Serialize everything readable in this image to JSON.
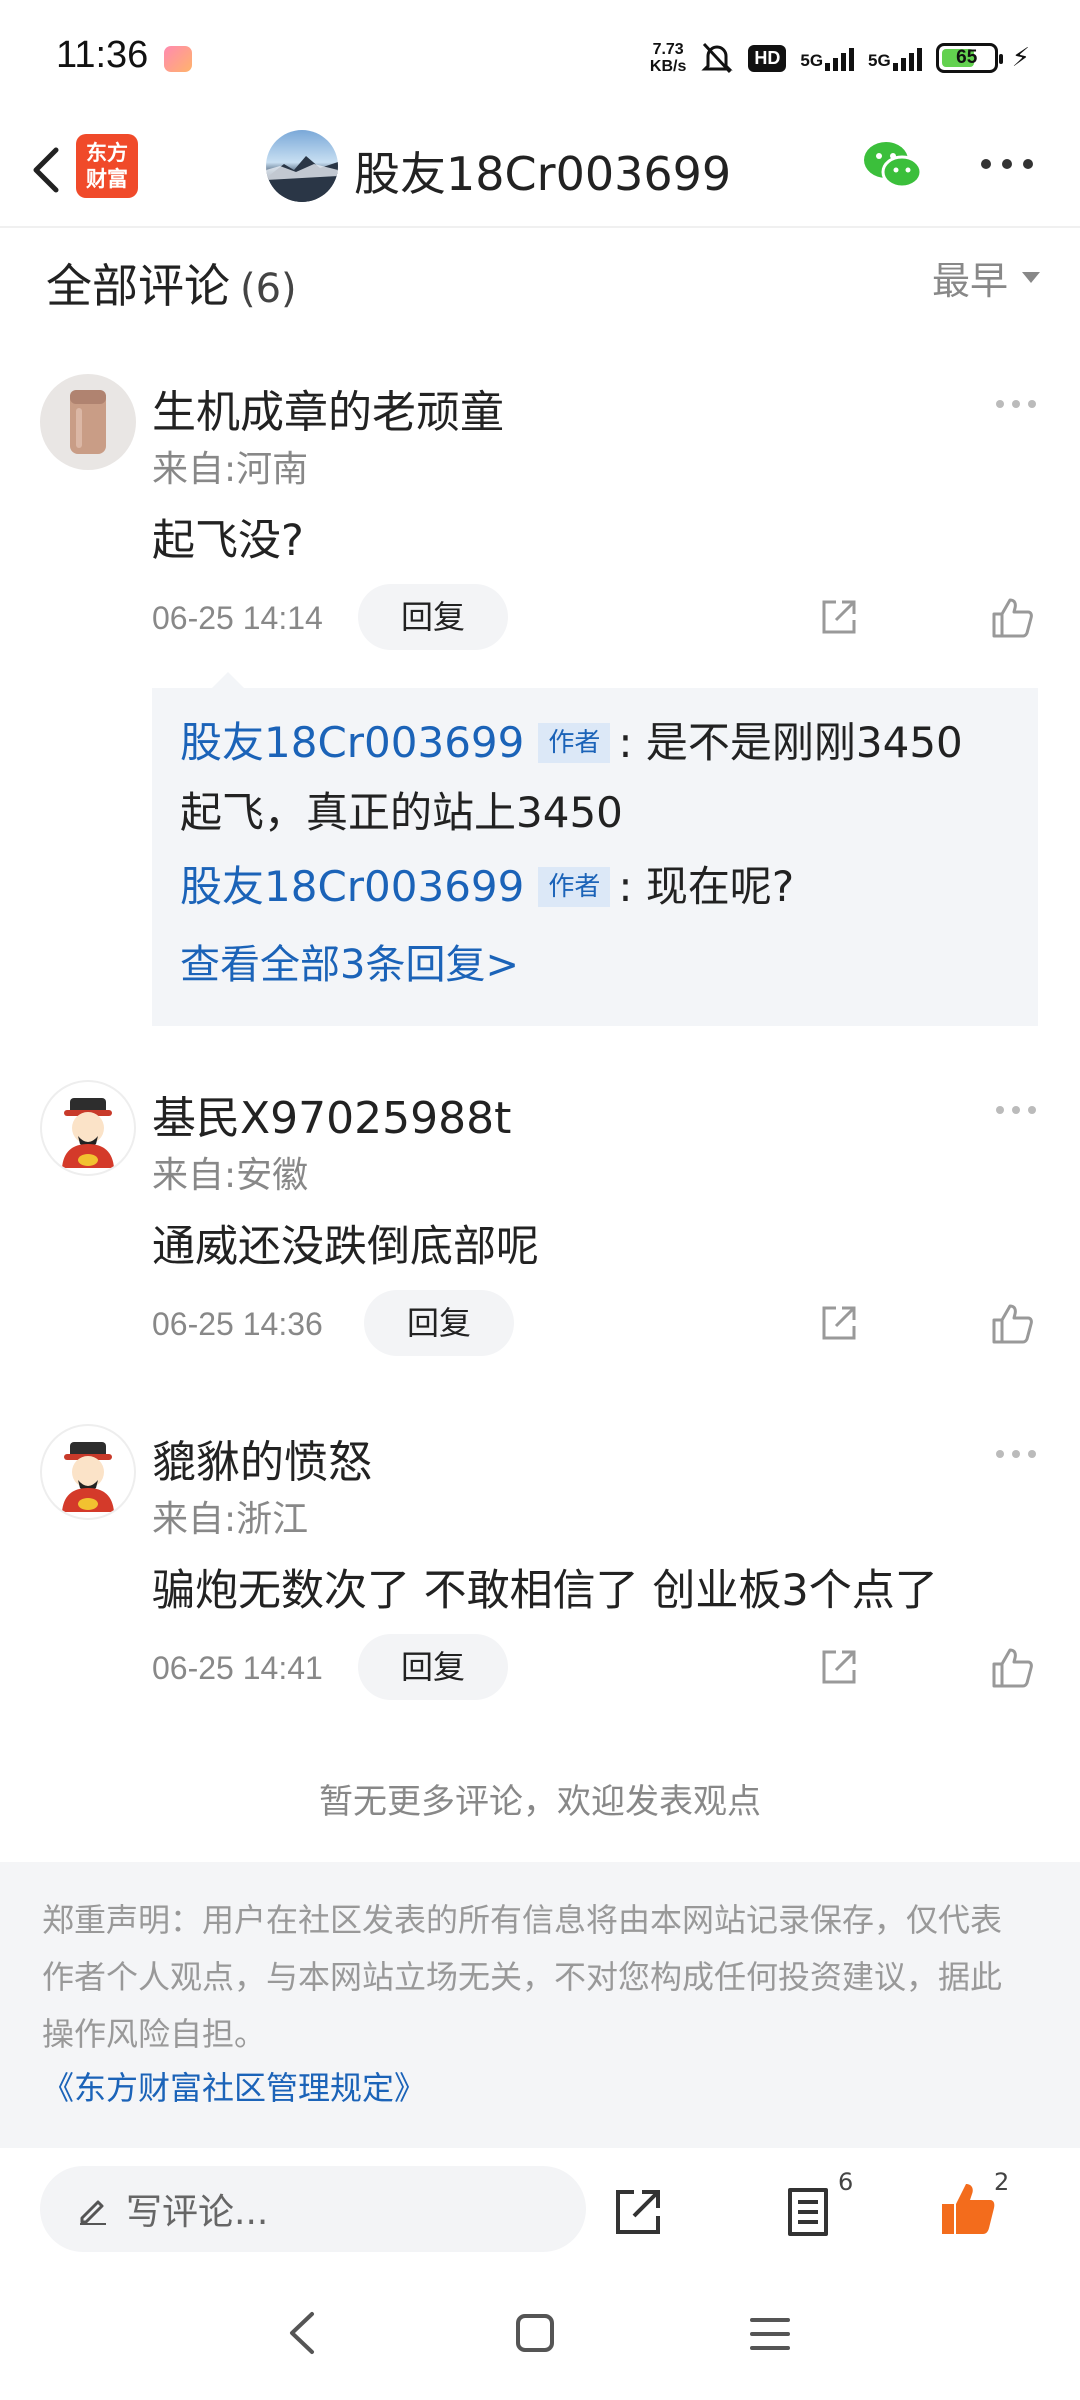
{
  "status_bar": {
    "time": "11:36",
    "net_speed_value": "7.73",
    "net_speed_unit": "KB/s",
    "hd_label": "HD",
    "signal_1": "5G",
    "signal_2": "5G",
    "battery_level": "65"
  },
  "header": {
    "logo_line1": "东方",
    "logo_line2": "财富",
    "title": "股友18Cr003699"
  },
  "comments_section": {
    "title": "全部评论",
    "count": "(6)",
    "sort_label": "最早"
  },
  "comments": [
    {
      "username": "生机成章的老顽童",
      "location": "来自:河南",
      "text": "起飞没?",
      "time": "06-25 14:14",
      "reply_label": "回复"
    },
    {
      "username": "基民X97025988t",
      "location": "来自:安徽",
      "text": "通威还没跌倒底部呢",
      "time": "06-25 14:36",
      "reply_label": "回复"
    },
    {
      "username": "貔貅的愤怒",
      "location": "来自:浙江",
      "text": "骗炮无数次了 不敢相信了 创业板3个点了",
      "time": "06-25 14:41",
      "reply_label": "回复"
    }
  ],
  "replies": [
    {
      "username": "股友18Cr003699",
      "tag": "作者",
      "text_line1": ": 是不是刚刚3450",
      "text_line2": "起飞，真正的站上3450"
    },
    {
      "username": "股友18Cr003699",
      "tag": "作者",
      "text_line1": ": 现在呢?"
    }
  ],
  "view_all_replies": "查看全部3条回复>",
  "no_more_text": "暂无更多评论，欢迎发表观点",
  "disclaimer": {
    "line1": "郑重声明：用户在社区发表的所有信息将由本网站记录保存，仅代表",
    "line2": "作者个人观点，与本网站立场无关，不对您构成任何投资建议，据此",
    "line3": "操作风险自担。",
    "link": "《东方财富社区管理规定》"
  },
  "bottom_bar": {
    "input_placeholder": "写评论...",
    "comments_count": "6",
    "likes_count": "2"
  },
  "colors": {
    "link_blue": "#1b63b8",
    "accent_orange": "#f36c1c",
    "logo_red": "#f04a2a",
    "wechat_green": "#3bbf3b"
  }
}
